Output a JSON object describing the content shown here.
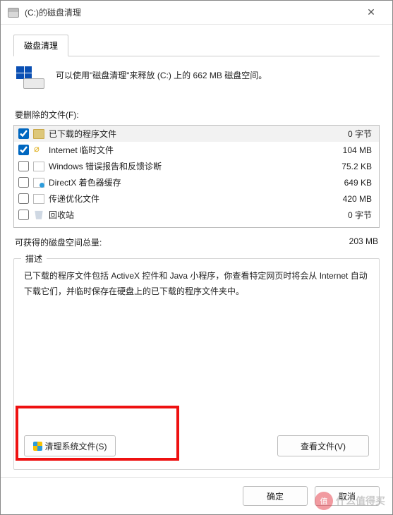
{
  "window": {
    "title": "(C:)的磁盘清理"
  },
  "tab": {
    "label": "磁盘清理"
  },
  "intro": "可以使用\"磁盘清理\"来释放  (C:) 上的 662 MB 磁盘空间。",
  "filesLabel": "要删除的文件(F):",
  "files": [
    {
      "checked": true,
      "iconClass": "fi-folder",
      "iconName": "folder-icon",
      "name": "已下载的程序文件",
      "size": "0 字节",
      "selected": true
    },
    {
      "checked": true,
      "iconClass": "fi-ie",
      "iconName": "internet-icon",
      "name": "Internet 临时文件",
      "size": "104 MB",
      "selected": false
    },
    {
      "checked": false,
      "iconClass": "fi-page",
      "iconName": "page-icon",
      "name": "Windows 错误报告和反馈诊断",
      "size": "75.2 KB",
      "selected": false
    },
    {
      "checked": false,
      "iconClass": "fi-dx",
      "iconName": "directx-icon",
      "name": "DirectX 着色器缓存",
      "size": "649 KB",
      "selected": false
    },
    {
      "checked": false,
      "iconClass": "fi-page",
      "iconName": "page-icon",
      "name": "传递优化文件",
      "size": "420 MB",
      "selected": false
    },
    {
      "checked": false,
      "iconClass": "fi-bin",
      "iconName": "recycle-bin-icon",
      "name": "回收站",
      "size": "0 字节",
      "selected": false
    }
  ],
  "totalLabel": "可获得的磁盘空间总量:",
  "totalValue": "203 MB",
  "descTitle": "描述",
  "descText": "已下载的程序文件包括 ActiveX 控件和 Java 小程序，你查看特定网页时将会从 Internet 自动下载它们，并临时保存在硬盘上的已下载的程序文件夹中。",
  "cleanSysBtn": "清理系统文件(S)",
  "viewFilesBtn": "查看文件(V)",
  "okBtn": "确定",
  "cancelBtn": "取消",
  "watermark": {
    "badge": "值",
    "text": "什么值得买"
  }
}
